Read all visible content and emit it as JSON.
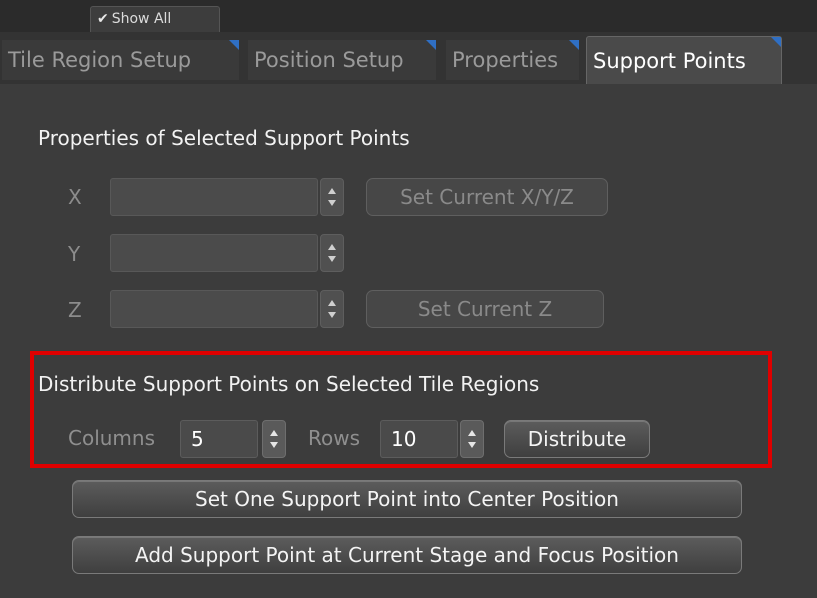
{
  "toolbar": {
    "show_all_label": "Show All"
  },
  "tabs": [
    {
      "label": "Tile Region Setup",
      "active": false
    },
    {
      "label": "Position Setup",
      "active": false
    },
    {
      "label": "Properties",
      "active": false
    },
    {
      "label": "Support Points",
      "active": true
    }
  ],
  "properties_section": {
    "title": "Properties of Selected Support Points",
    "x_label": "X",
    "y_label": "Y",
    "z_label": "Z",
    "x_value": "",
    "y_value": "",
    "z_value": "",
    "set_current_xyz_label": "Set Current X/Y/Z",
    "set_current_z_label": "Set Current Z"
  },
  "distribute_section": {
    "title": "Distribute Support Points on Selected Tile Regions",
    "columns_label": "Columns",
    "columns_value": "5",
    "rows_label": "Rows",
    "rows_value": "10",
    "distribute_label": "Distribute"
  },
  "actions": {
    "center_label": "Set One Support Point into Center Position",
    "add_label": "Add Support Point at Current Stage and Focus Position"
  },
  "colors": {
    "active_tab_marker": "#2f6fc4",
    "highlight_border": "#e00000"
  }
}
